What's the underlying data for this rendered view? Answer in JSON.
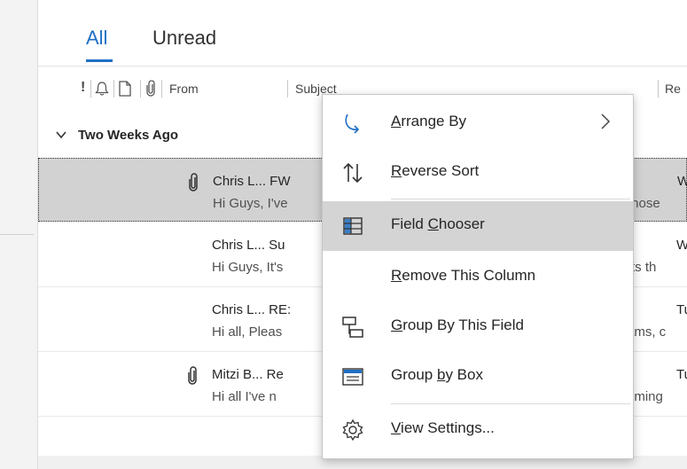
{
  "tabs": {
    "all": "All",
    "unread": "Unread"
  },
  "columns": {
    "importance": "!",
    "from": "From",
    "subject": "Subject",
    "received": "Re"
  },
  "group": {
    "label": "Two Weeks Ago"
  },
  "messages": [
    {
      "from_subject": "Chris L... FW",
      "preview": "Hi Guys,  I've",
      "date": "We",
      "preview_right": "those",
      "attachment": true,
      "selected": true
    },
    {
      "from_subject": "Chris L... Su",
      "preview": "Hi Guys,  It's",
      "date": "We",
      "preview_right": "rts th",
      "attachment": false,
      "selected": false
    },
    {
      "from_subject": "Chris L... RE:",
      "preview": "Hi all,  Pleas",
      "date": "Tu",
      "preview_right": "ams, c",
      "attachment": false,
      "selected": false
    },
    {
      "from_subject": "Mitzi B... Re",
      "preview": "Hi all  I've n",
      "date": "Tu",
      "preview_right": "oming",
      "attachment": true,
      "selected": false
    }
  ],
  "context_menu": {
    "items": [
      {
        "pre": "",
        "u": "A",
        "post": "rrange By",
        "icon": "arrange-by-icon",
        "submenu": true
      },
      {
        "pre": "",
        "u": "R",
        "post": "everse Sort",
        "icon": "reverse-sort-icon"
      },
      {
        "pre": "Field ",
        "u": "C",
        "post": "hooser",
        "icon": "field-chooser-icon",
        "highlighted": true
      },
      {
        "pre": "",
        "u": "R",
        "post": "emove This Column",
        "icon": ""
      },
      {
        "pre": "",
        "u": "G",
        "post": "roup By This Field",
        "icon": "group-by-field-icon"
      },
      {
        "pre": "Group ",
        "u": "b",
        "post": "y Box",
        "icon": "group-by-box-icon"
      },
      {
        "pre": "",
        "u": "V",
        "post": "iew Settings...",
        "icon": "view-settings-icon"
      }
    ]
  },
  "colors": {
    "accent": "#1f6fc5",
    "selected_row": "#d2d2d2",
    "menu_highlight": "#d4d4d4"
  }
}
